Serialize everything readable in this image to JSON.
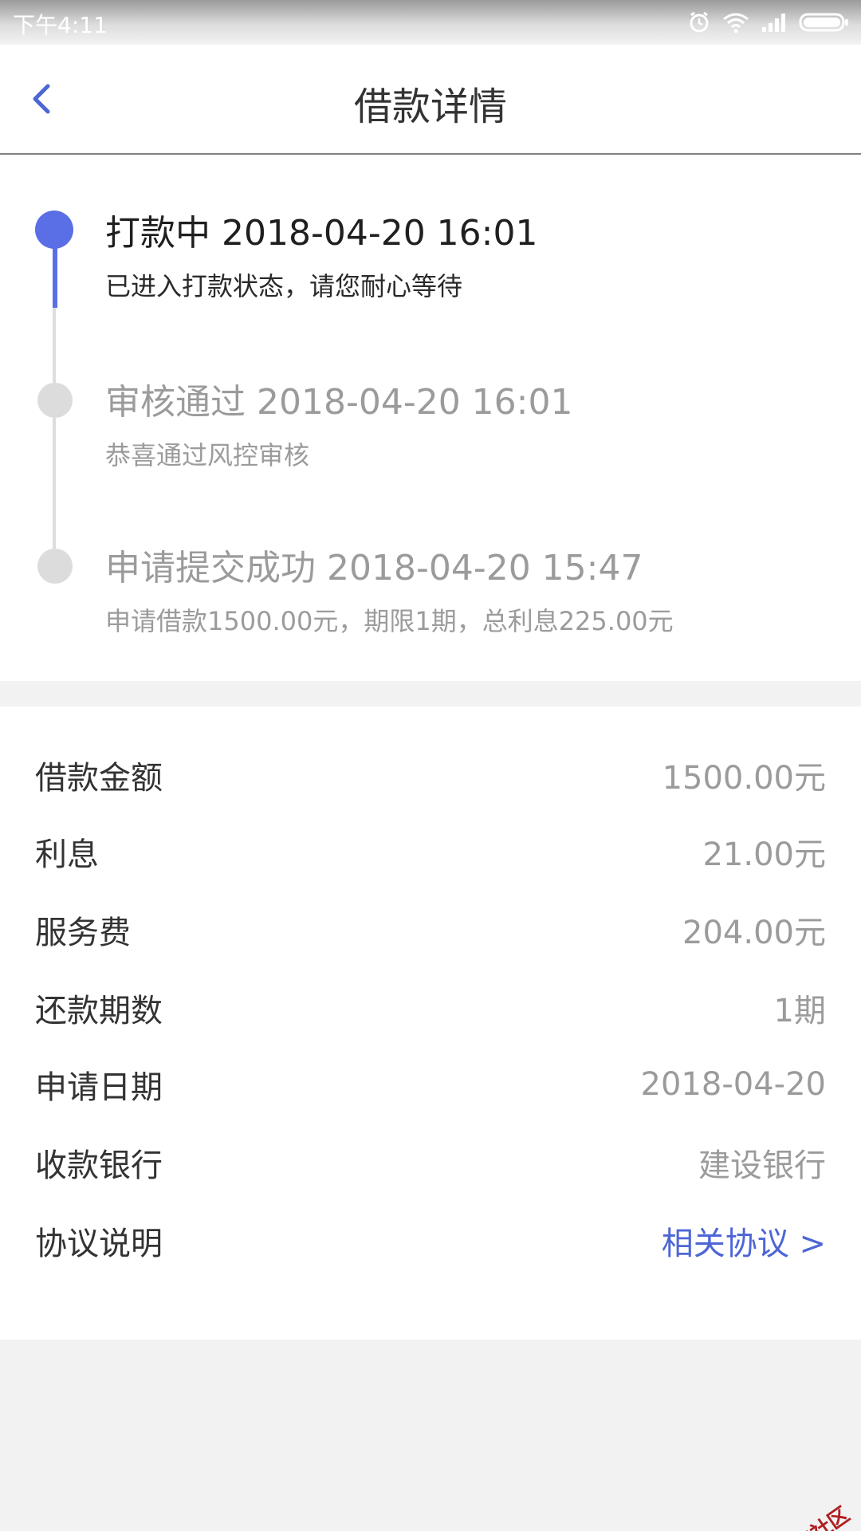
{
  "status_bar": {
    "time": "下午4:11",
    "icons": [
      "alarm-icon",
      "wifi-icon",
      "signal-icon",
      "battery-icon"
    ]
  },
  "nav": {
    "back_icon": "chevron-left-icon",
    "title": "借款详情"
  },
  "timeline": {
    "items": [
      {
        "state": "active",
        "title": "打款中 2018-04-20 16:01",
        "desc": "已进入打款状态，请您耐心等待"
      },
      {
        "state": "done",
        "title": "审核通过 2018-04-20 16:01",
        "desc": "恭喜通过风控审核"
      },
      {
        "state": "done",
        "title": "申请提交成功 2018-04-20 15:47",
        "desc": "申请借款1500.00元，期限1期，总利息225.00元"
      }
    ]
  },
  "details": {
    "rows": [
      {
        "label": "借款金额",
        "value": "1500.00元"
      },
      {
        "label": "利息",
        "value": "21.00元"
      },
      {
        "label": "服务费",
        "value": "204.00元"
      },
      {
        "label": "还款期数",
        "value": "1期"
      },
      {
        "label": "申请日期",
        "value": "2018-04-20"
      },
      {
        "label": "收款银行",
        "value": "建设银行"
      },
      {
        "label": "协议说明",
        "value": "相关协议 >"
      }
    ]
  },
  "watermark": "卡农社区",
  "colors": {
    "accent": "#5a6ee6",
    "link": "#4d66d6",
    "muted_text": "#9b9b9b",
    "background": "#f2f2f2"
  }
}
